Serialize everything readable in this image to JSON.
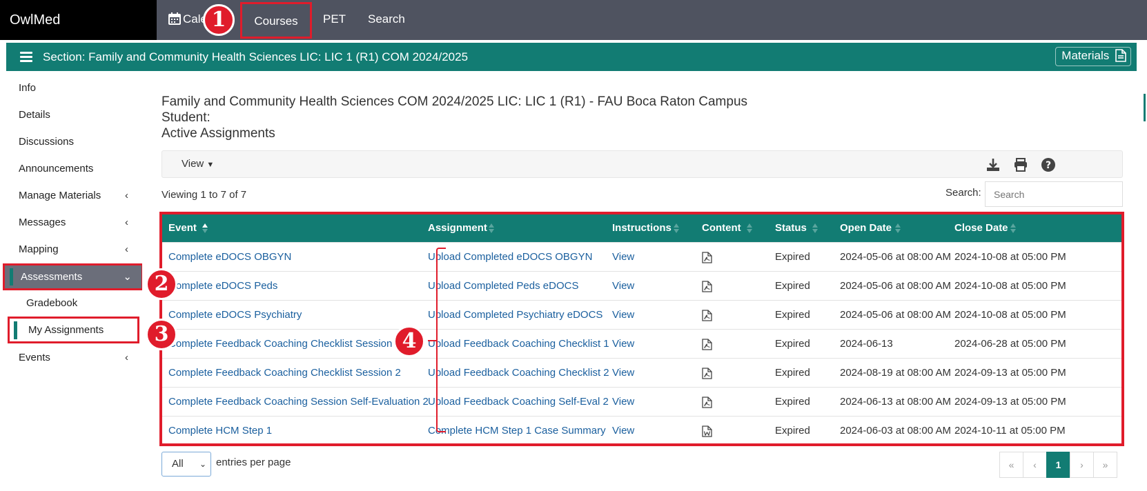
{
  "topnav": {
    "brand": "OwlMed",
    "calendar_label": "Cale",
    "courses_label": "Courses",
    "pet_label": "PET",
    "search_label": "Search"
  },
  "section": {
    "title": "Section: Family and Community Health Sciences LIC: LIC 1 (R1) COM 2024/2025",
    "materials_label": "Materials"
  },
  "sidebar": {
    "items": [
      {
        "label": "Info"
      },
      {
        "label": "Details"
      },
      {
        "label": "Discussions"
      },
      {
        "label": "Announcements"
      },
      {
        "label": "Manage Materials",
        "chevron": "‹"
      },
      {
        "label": "Messages",
        "chevron": "‹"
      },
      {
        "label": "Mapping",
        "chevron": "‹"
      },
      {
        "label": "Assessments",
        "chevron": "⌄"
      },
      {
        "label": "Gradebook"
      },
      {
        "label": "My Assignments"
      },
      {
        "label": "Events",
        "chevron": "‹"
      }
    ]
  },
  "main": {
    "heading_line1": "Family and Community Health Sciences COM 2024/2025 LIC: LIC 1 (R1) - FAU Boca Raton Campus",
    "heading_line2": "Student:",
    "heading_line3": "Active Assignments",
    "view_label": "View",
    "viewing_text": "Viewing 1 to 7 of 7",
    "search_label": "Search:",
    "search_placeholder": "Search"
  },
  "table": {
    "columns": [
      "Event",
      "Assignment",
      "Instructions",
      "Content",
      "Status",
      "Open Date",
      "Close Date"
    ],
    "rows": [
      {
        "event": "Complete eDOCS OBGYN",
        "assignment": "Upload Completed eDOCS OBGYN",
        "instructions": "View",
        "content": "pdf-icon",
        "status": "Expired",
        "open": "2024-05-06 at 08:00 AM",
        "close": "2024-10-08 at 05:00 PM"
      },
      {
        "event": "Complete eDOCS Peds",
        "assignment": "Upload Completed Peds eDOCS",
        "instructions": "View",
        "content": "pdf-icon",
        "status": "Expired",
        "open": "2024-05-06 at 08:00 AM",
        "close": "2024-10-08 at 05:00 PM"
      },
      {
        "event": "Complete eDOCS Psychiatry",
        "assignment": "Upload Completed Psychiatry eDOCS",
        "instructions": "View",
        "content": "pdf-icon",
        "status": "Expired",
        "open": "2024-05-06 at 08:00 AM",
        "close": "2024-10-08 at 05:00 PM"
      },
      {
        "event": "Complete Feedback Coaching Checklist Session 1",
        "assignment": "Upload Feedback Coaching Checklist 1",
        "instructions": "View",
        "content": "pdf-icon",
        "status": "Expired",
        "open": "2024-06-13",
        "close": "2024-06-28 at 05:00 PM"
      },
      {
        "event": "Complete Feedback Coaching Checklist Session 2",
        "assignment": "Upload Feedback Coaching Checklist 2",
        "instructions": "View",
        "content": "pdf-icon",
        "status": "Expired",
        "open": "2024-08-19 at 08:00 AM",
        "close": "2024-09-13 at 05:00 PM"
      },
      {
        "event": "Complete Feedback Coaching Session Self-Evaluation 2",
        "assignment": "Upload Feedback Coaching Self-Eval 2",
        "instructions": "View",
        "content": "pdf-icon",
        "status": "Expired",
        "open": "2024-06-13 at 08:00 AM",
        "close": "2024-09-13 at 05:00 PM"
      },
      {
        "event": "Complete HCM Step 1",
        "assignment": "Complete HCM Step 1 Case Summary",
        "instructions": "View",
        "content": "word-icon",
        "status": "Expired",
        "open": "2024-06-03 at 08:00 AM",
        "close": "2024-10-11 at 05:00 PM"
      }
    ]
  },
  "footer": {
    "entries_value": "All",
    "entries_label": "entries per page",
    "pager": [
      "«",
      "‹",
      "1",
      "›",
      "»"
    ]
  },
  "annotations": [
    "1",
    "2",
    "3",
    "4"
  ],
  "colors": {
    "teal": "#127c73",
    "nav": "#4f5360",
    "highlight": "#e01c2b",
    "link": "#1a5f9e",
    "sidebar_active": "#6b6e7a"
  }
}
